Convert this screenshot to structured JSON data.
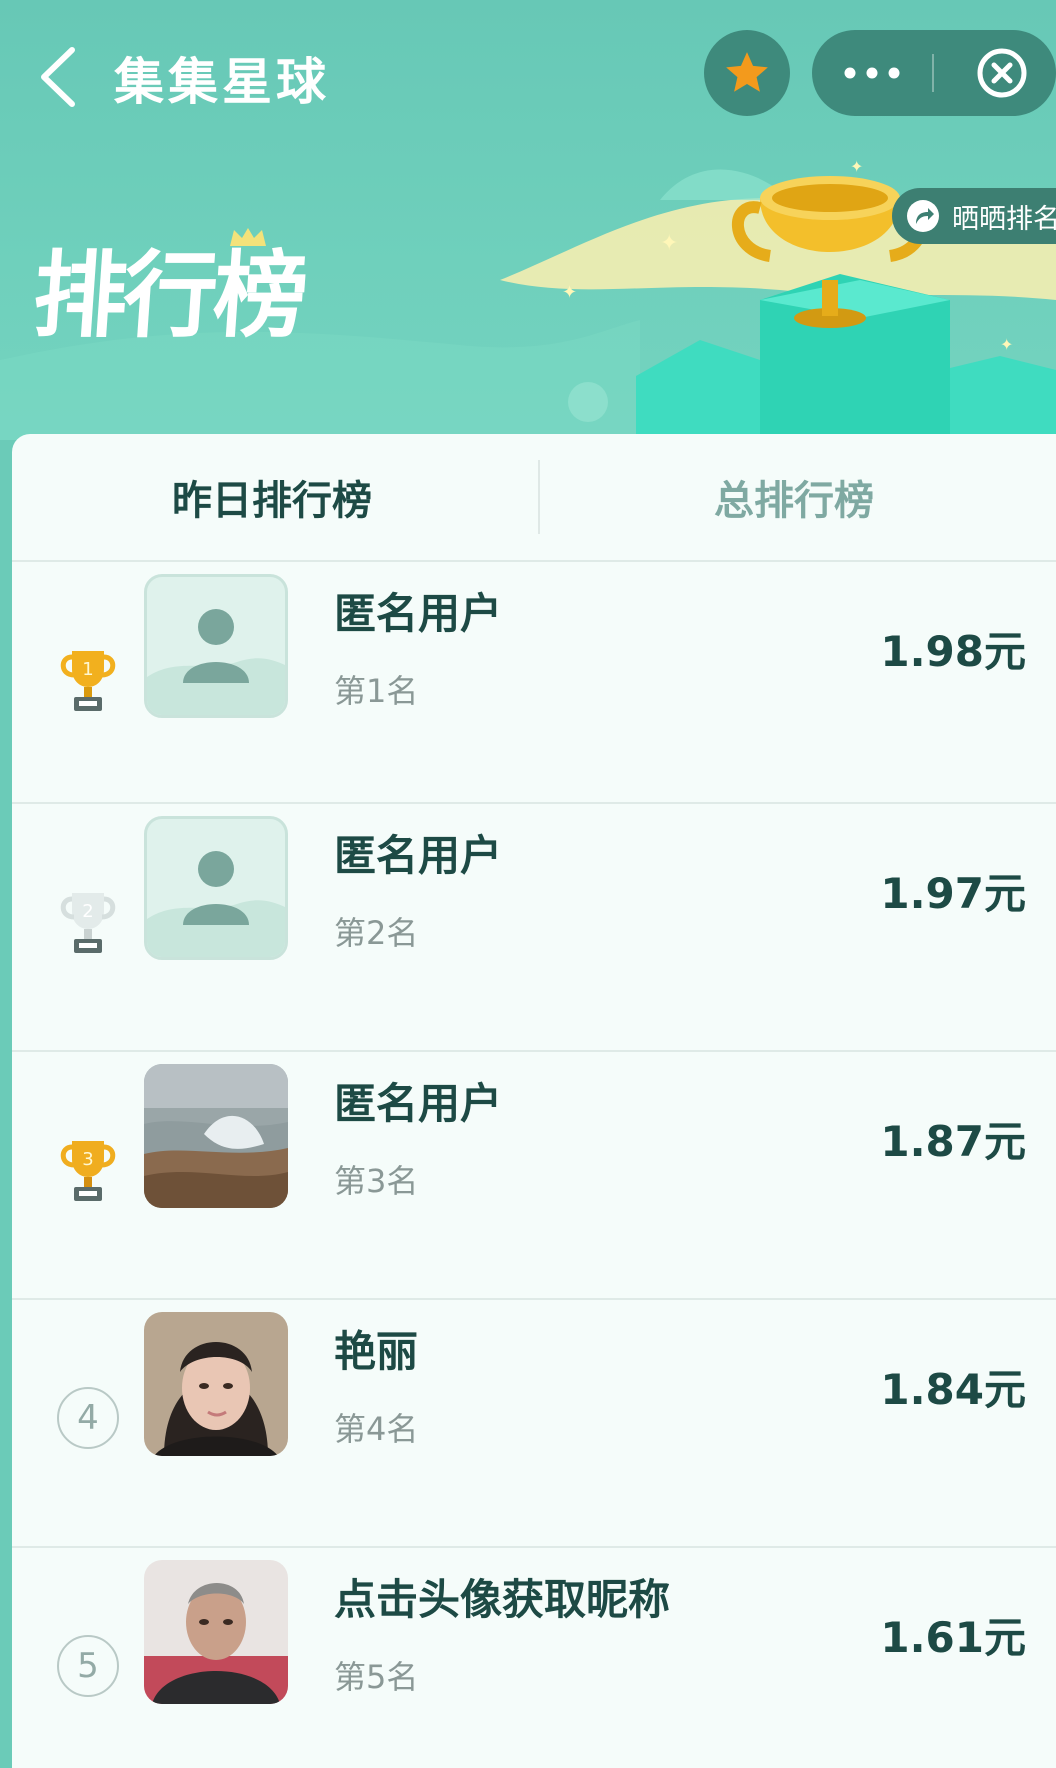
{
  "header": {
    "app_title": "集集星球",
    "banner_title": "排行榜",
    "share_label": "晒晒排名"
  },
  "tabs": [
    {
      "label": "昨日排行榜",
      "active": true
    },
    {
      "label": "总排行榜",
      "active": false
    }
  ],
  "ranking": [
    {
      "rank": "1",
      "name": "匿名用户",
      "rank_label": "第1名",
      "amount": "1.98元",
      "badge": "gold-trophy",
      "avatar": "anonymous"
    },
    {
      "rank": "2",
      "name": "匿名用户",
      "rank_label": "第2名",
      "amount": "1.97元",
      "badge": "silver-trophy",
      "avatar": "anonymous"
    },
    {
      "rank": "3",
      "name": "匿名用户",
      "rank_label": "第3名",
      "amount": "1.87元",
      "badge": "bronze-trophy",
      "avatar": "seaside-photo"
    },
    {
      "rank": "4",
      "name": "艳丽",
      "rank_label": "第4名",
      "amount": "1.84元",
      "badge": "number-circle",
      "avatar": "woman-photo"
    },
    {
      "rank": "5",
      "name": "点击头像获取昵称",
      "rank_label": "第5名",
      "amount": "1.61元",
      "badge": "number-circle",
      "avatar": "man-photo"
    }
  ],
  "colors": {
    "header_bg": "#6bcbb8",
    "capsule_bg": "#3e8a7c",
    "card_bg": "#f5fcfa",
    "text_dark": "#1d4a45",
    "tab_inactive": "#7fa9a2",
    "gold": "#f2b01e",
    "star": "#f39a1c"
  }
}
